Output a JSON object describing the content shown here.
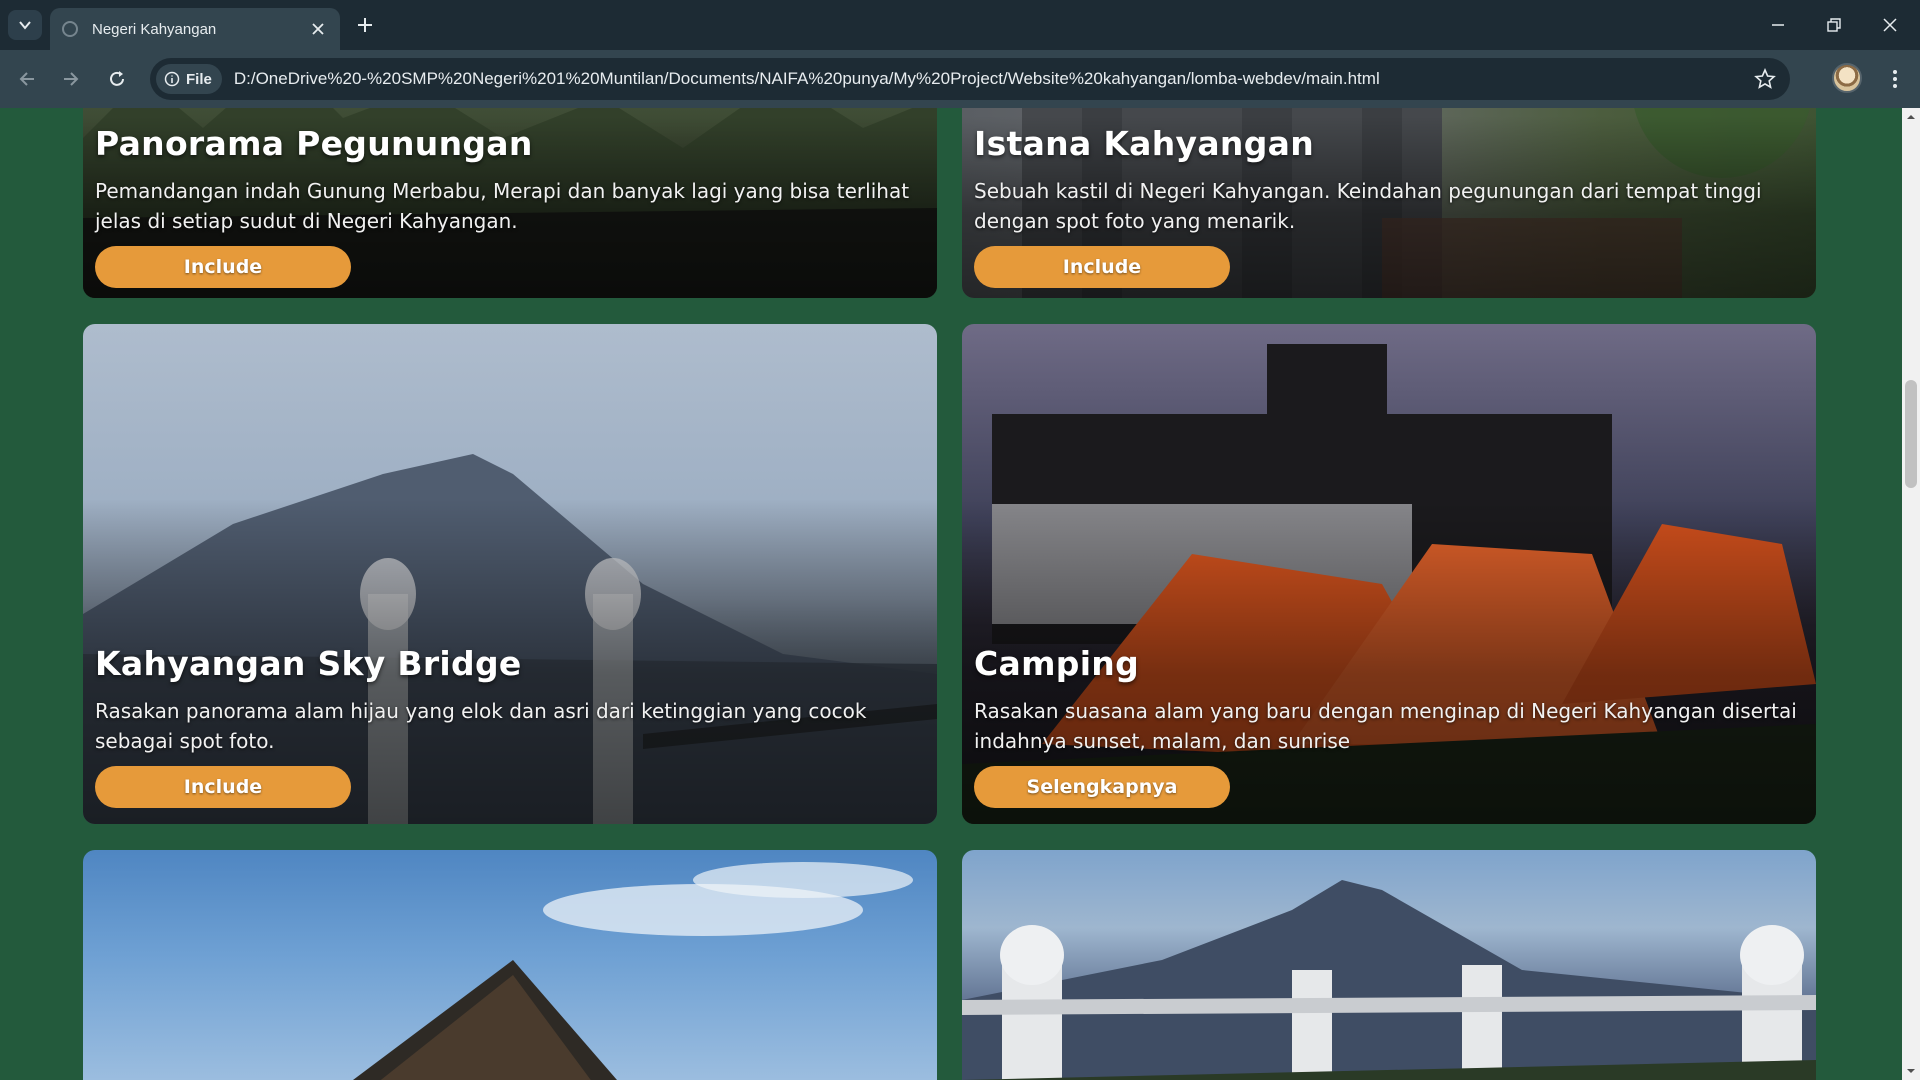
{
  "browser": {
    "tab_title": "Negeri Kahyangan",
    "omnibox_chip": "File",
    "url": "D:/OneDrive%20-%20SMP%20Negeri%201%20Muntilan/Documents/NAIFA%20punya/My%20Project/Website%20kahyangan/lomba-webdev/main.html",
    "accent": "#e69a3a",
    "page_background": "#235a3c"
  },
  "cards": [
    {
      "title": "Panorama Pegunungan",
      "description": "Pemandangan indah Gunung Merbabu, Merapi dan banyak lagi yang bisa terlihat jelas di setiap sudut di Negeri Kahyangan.",
      "button": "Include"
    },
    {
      "title": "Istana Kahyangan",
      "description": "Sebuah kastil di Negeri Kahyangan. Keindahan pegunungan dari tempat tinggi dengan spot foto yang menarik.",
      "button": "Include"
    },
    {
      "title": "Kahyangan Sky Bridge",
      "description": "Rasakan panorama alam hijau yang elok dan asri dari ketinggian yang cocok sebagai spot foto.",
      "button": "Include"
    },
    {
      "title": "Camping",
      "description": "Rasakan suasana alam yang baru dengan menginap di Negeri Kahyangan disertai indahnya sunset, malam, dan sunrise",
      "button": "Selengkapnya"
    }
  ]
}
